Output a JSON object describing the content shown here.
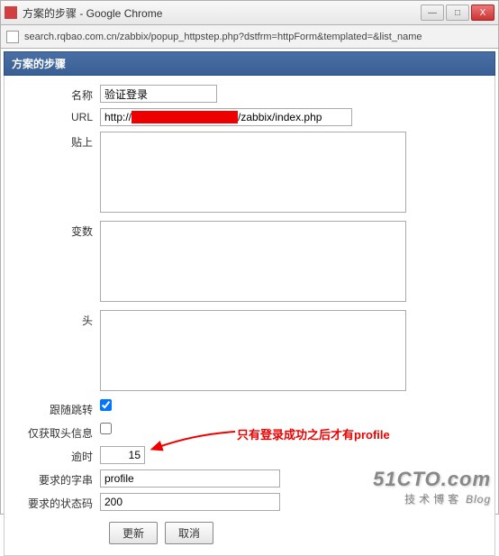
{
  "window": {
    "title": "方案的步骤 - Google Chrome",
    "url": "search.rqbao.com.cn/zabbix/popup_httpstep.php?dstfrm=httpForm&templated=&list_name",
    "buttons": {
      "min": "—",
      "max": "□",
      "close": "X"
    }
  },
  "panel": {
    "title": "方案的步骤"
  },
  "form": {
    "name": {
      "label": "名称",
      "value": "验证登录"
    },
    "url": {
      "label": "URL",
      "prefix": "http://",
      "suffix": "/zabbix/index.php"
    },
    "post": {
      "label": "贴上",
      "value": ""
    },
    "variables": {
      "label": "变数",
      "value": ""
    },
    "headers": {
      "label": "头",
      "value": ""
    },
    "follow": {
      "label": "跟随跳转",
      "checked": true
    },
    "headonly": {
      "label": "仅获取头信息",
      "checked": false
    },
    "timeout": {
      "label": "逾时",
      "value": "15"
    },
    "required": {
      "label": "要求的字串",
      "value": "profile"
    },
    "status": {
      "label": "要求的状态码",
      "value": "200"
    }
  },
  "buttons": {
    "update": "更新",
    "cancel": "取消"
  },
  "annotation": {
    "text": "只有登录成功之后才有profile"
  },
  "watermark": {
    "main": "51CTO.com",
    "sub": "技术博客",
    "blog": "Blog"
  }
}
